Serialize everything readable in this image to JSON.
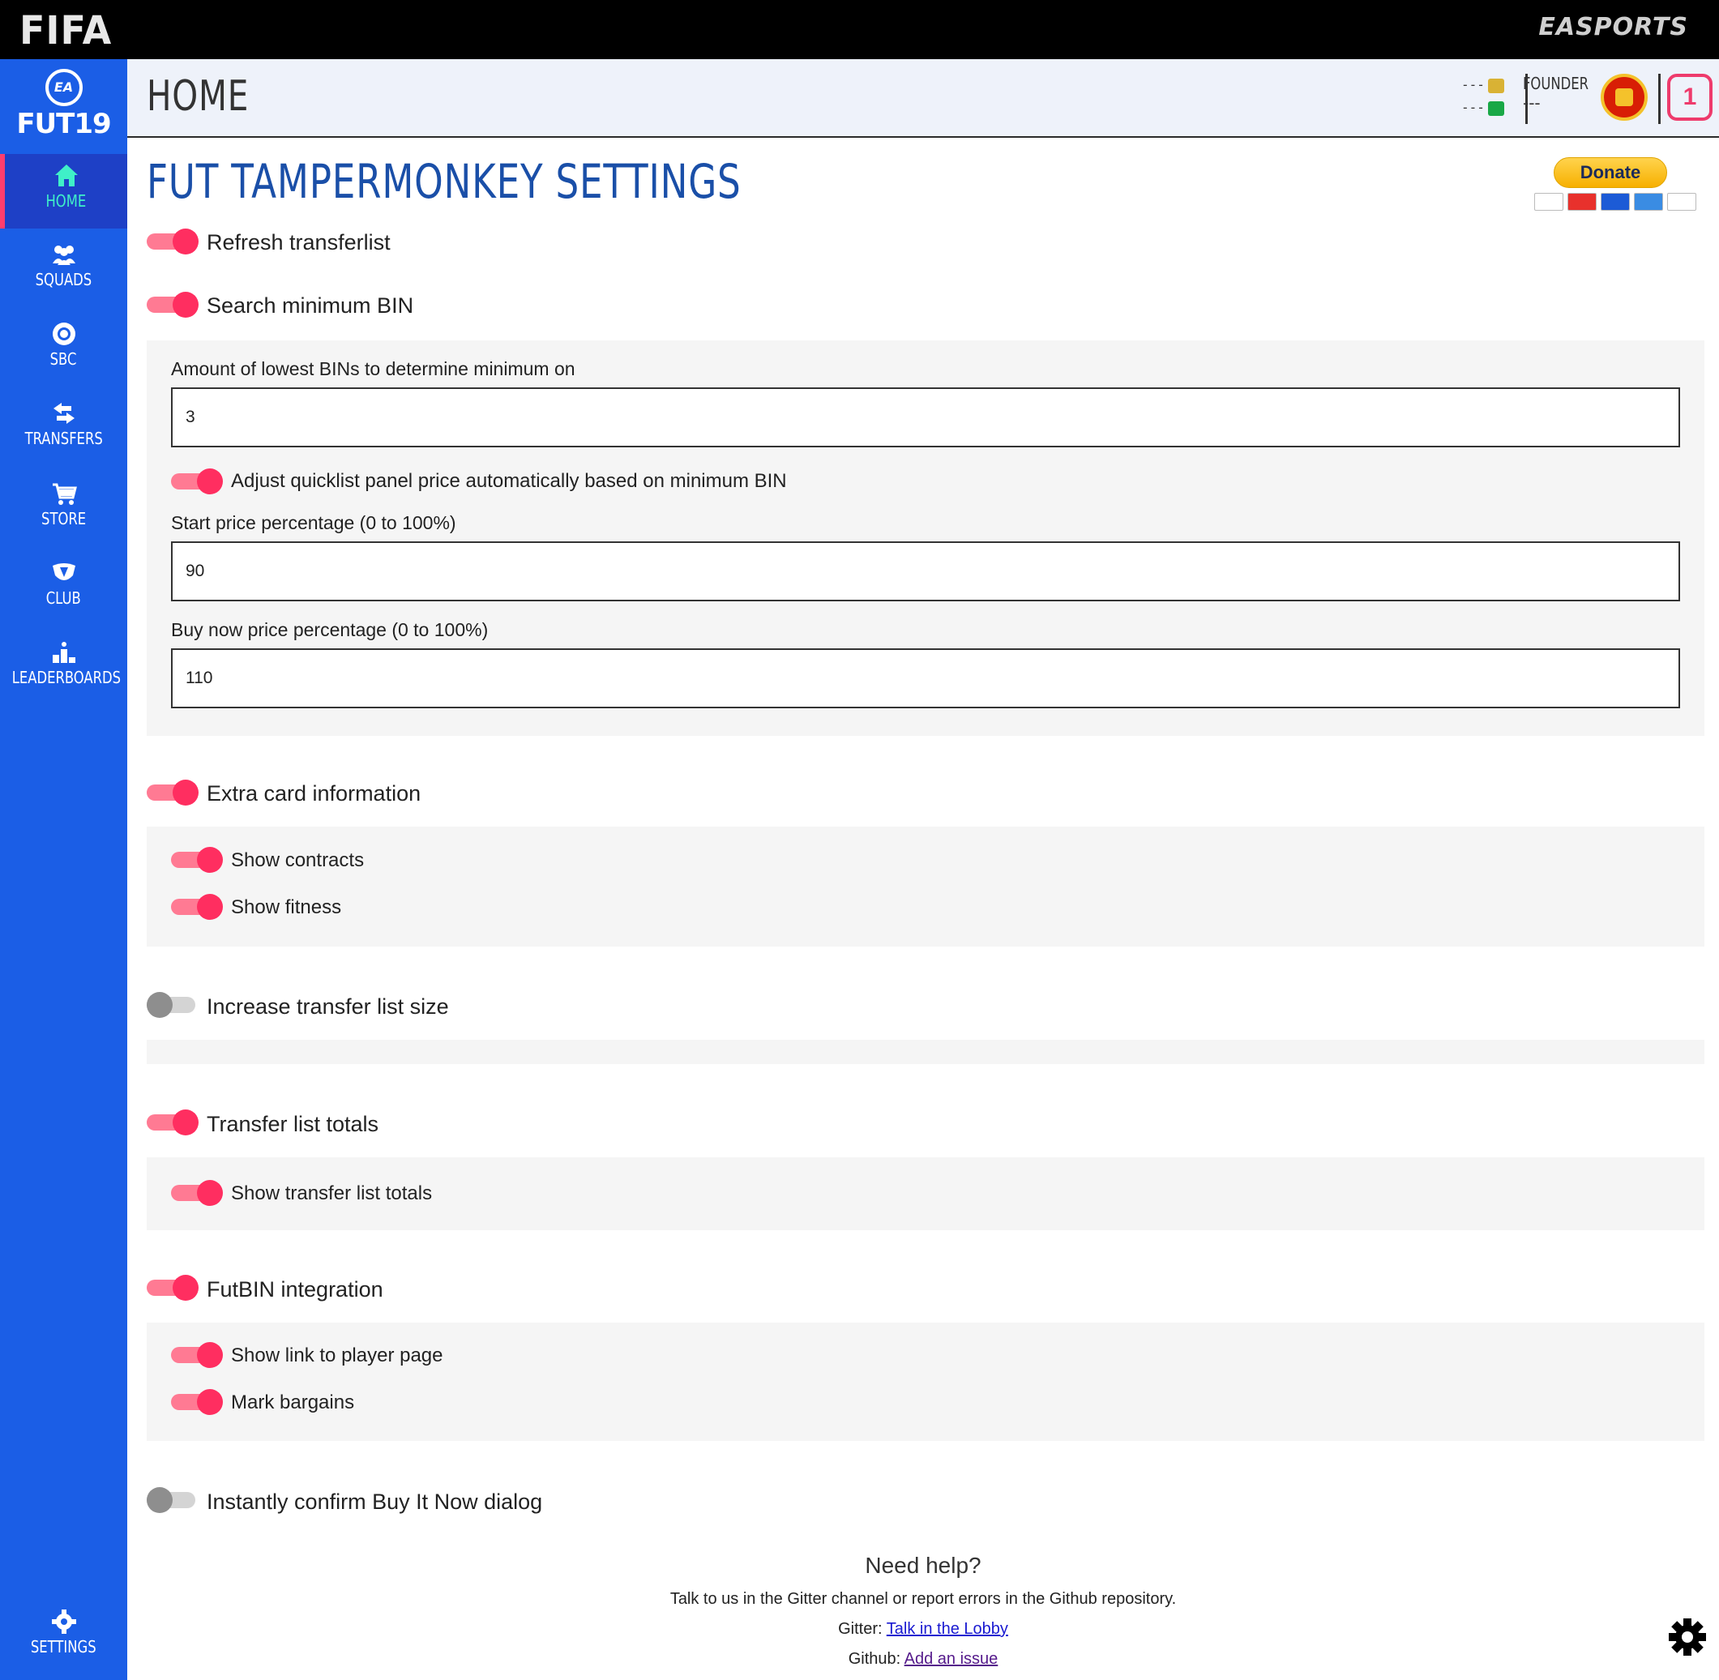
{
  "topbar": {
    "brand": "FIFA",
    "publisher": "EASPORTS"
  },
  "sidebar": {
    "logo_badge": "EA SPORTS",
    "logo_text": "FUT19",
    "items": [
      {
        "label": "HOME",
        "icon": "home-icon",
        "active": true
      },
      {
        "label": "SQUADS",
        "icon": "squads-icon"
      },
      {
        "label": "SBC",
        "icon": "sbc-icon"
      },
      {
        "label": "TRANSFERS",
        "icon": "transfers-icon"
      },
      {
        "label": "STORE",
        "icon": "store-icon"
      },
      {
        "label": "CLUB",
        "icon": "club-icon"
      },
      {
        "label": "LEADERBOARDS",
        "icon": "leaderboards-icon"
      }
    ],
    "settings_label": "SETTINGS"
  },
  "header": {
    "title": "HOME",
    "coins": "---",
    "points": "---",
    "club_label": "FOUNDER",
    "club_value": "---",
    "rank": "1"
  },
  "settings": {
    "title": "FUT TAMPERMONKEY SETTINGS",
    "donate_label": "Donate",
    "refresh_transferlist": "Refresh transferlist",
    "search_min_bin": "Search minimum BIN",
    "min_bin_amount_label": "Amount of lowest BINs to determine minimum on",
    "min_bin_amount_value": "3",
    "adjust_quicklist": "Adjust quicklist panel price automatically based on minimum BIN",
    "start_price_label": "Start price percentage (0 to 100%)",
    "start_price_value": "90",
    "buy_now_label": "Buy now price percentage (0 to 100%)",
    "buy_now_value": "110",
    "extra_card_info": "Extra card information",
    "show_contracts": "Show contracts",
    "show_fitness": "Show fitness",
    "increase_list_size": "Increase transfer list size",
    "transfer_list_totals": "Transfer list totals",
    "show_transfer_list_totals": "Show transfer list totals",
    "futbin_integration": "FutBIN integration",
    "show_link_player_page": "Show link to player page",
    "mark_bargains": "Mark bargains",
    "instant_confirm": "Instantly confirm Buy It Now dialog"
  },
  "help": {
    "title": "Need help?",
    "text": "Talk to us in the Gitter channel or report errors in the Github repository.",
    "gitter_label": "Gitter:",
    "gitter_link": "Talk in the Lobby",
    "github_label": "Github:",
    "github_link": "Add an issue"
  },
  "colors": {
    "sidebar": "#1b5ee6",
    "accent": "#ff2e60",
    "title": "#1a4fa8",
    "active_nav": "#3ff0c8"
  }
}
